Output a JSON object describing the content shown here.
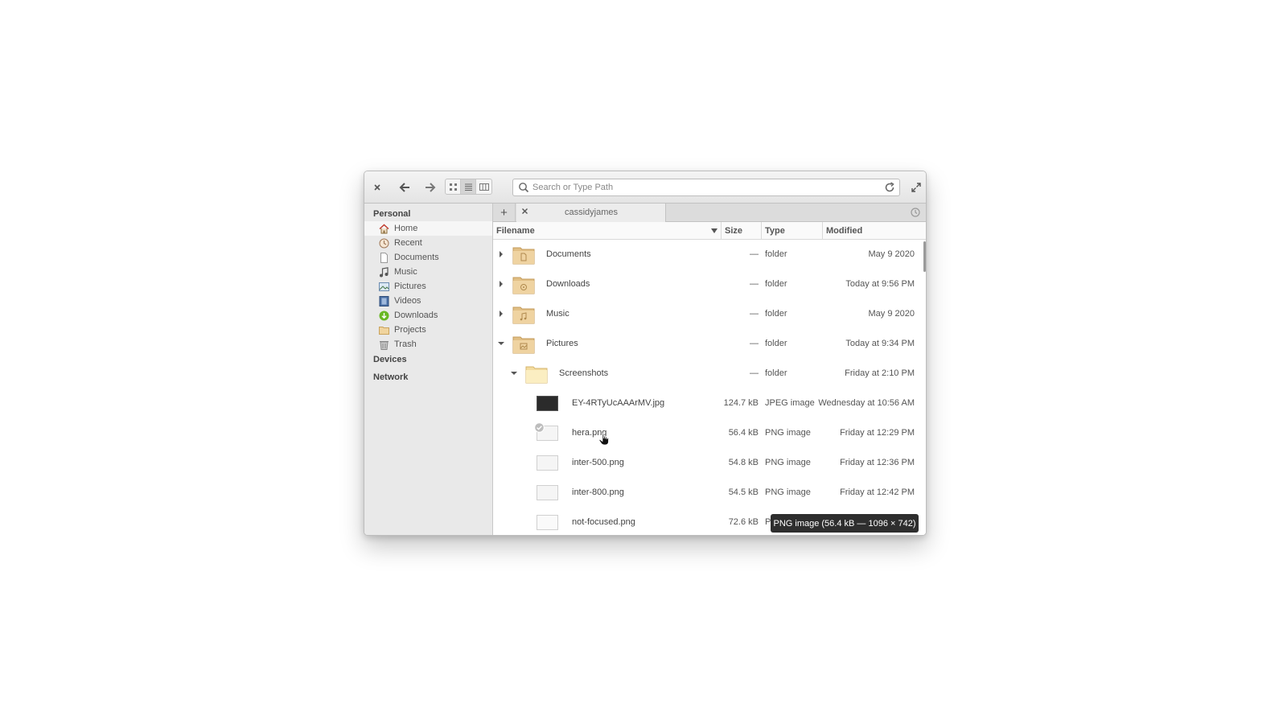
{
  "window": {
    "search_placeholder": "Search or Type Path"
  },
  "sidebar": {
    "sections": [
      {
        "label": "Personal"
      },
      {
        "label": "Devices"
      },
      {
        "label": "Network"
      }
    ],
    "items": [
      {
        "label": "Home",
        "icon": "home-icon",
        "selected": true
      },
      {
        "label": "Recent",
        "icon": "recent-icon"
      },
      {
        "label": "Documents",
        "icon": "documents-icon"
      },
      {
        "label": "Music",
        "icon": "music-icon"
      },
      {
        "label": "Pictures",
        "icon": "pictures-icon"
      },
      {
        "label": "Videos",
        "icon": "videos-icon"
      },
      {
        "label": "Downloads",
        "icon": "downloads-icon"
      },
      {
        "label": "Projects",
        "icon": "projects-folder-icon"
      },
      {
        "label": "Trash",
        "icon": "trash-icon"
      }
    ]
  },
  "tabs": [
    {
      "label": "cassidyjames"
    }
  ],
  "columns": {
    "filename": "Filename",
    "size": "Size",
    "type": "Type",
    "modified": "Modified"
  },
  "files": [
    {
      "name": "Documents",
      "size": "—",
      "type": "folder",
      "modified": "May  9 2020",
      "kind": "folder",
      "emblem": "document"
    },
    {
      "name": "Downloads",
      "size": "—",
      "type": "folder",
      "modified": "Today at 9:56 PM",
      "kind": "folder",
      "emblem": "download"
    },
    {
      "name": "Music",
      "size": "—",
      "type": "folder",
      "modified": "May  9 2020",
      "kind": "folder",
      "emblem": "music"
    },
    {
      "name": "Pictures",
      "size": "—",
      "type": "folder",
      "modified": "Today at 9:34 PM",
      "kind": "folder",
      "emblem": "picture"
    },
    {
      "name": "Screenshots",
      "size": "—",
      "type": "folder",
      "modified": "Friday at 2:10 PM",
      "kind": "folder"
    },
    {
      "name": "EY-4RTyUcAAArMV.jpg",
      "size": "124.7 kB",
      "type": "JPEG image",
      "modified": "Wednesday at 10:56 AM",
      "kind": "image"
    },
    {
      "name": "hera.png",
      "size": "56.4 kB",
      "type": "PNG image",
      "modified": "Friday at 12:29 PM",
      "kind": "image"
    },
    {
      "name": "inter-500.png",
      "size": "54.8 kB",
      "type": "PNG image",
      "modified": "Friday at 12:36 PM",
      "kind": "image"
    },
    {
      "name": "inter-800.png",
      "size": "54.5 kB",
      "type": "PNG image",
      "modified": "Friday at 12:42 PM",
      "kind": "image"
    },
    {
      "name": "not-focused.png",
      "size": "72.6 kB",
      "type": "P",
      "modified": "",
      "kind": "image"
    }
  ],
  "tooltip": "PNG image (56.4 kB — 1096 × 742)",
  "colors": {
    "folder": "#e8c88e",
    "accent_green": "#68b723"
  }
}
